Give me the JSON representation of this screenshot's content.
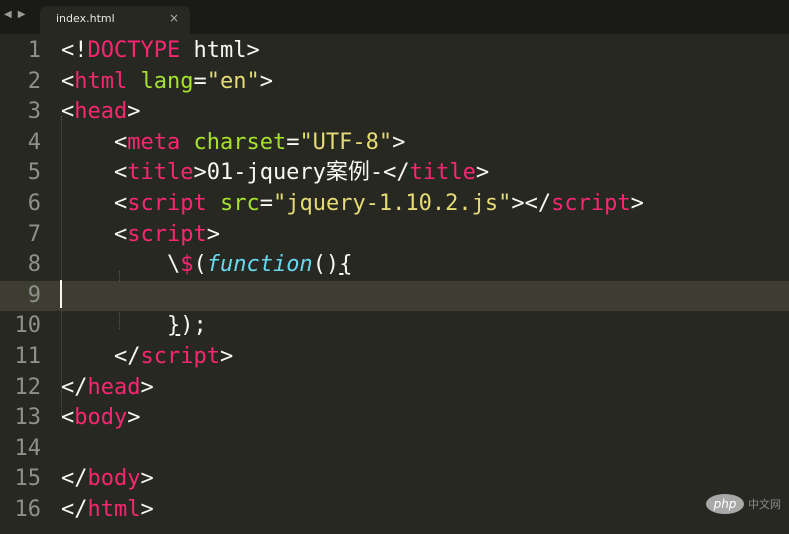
{
  "tabbar": {
    "nav_left": "◀",
    "nav_right": "▶",
    "tab_label": "index.html",
    "tab_close": "×"
  },
  "editor": {
    "current_line": 9,
    "lines": [
      {
        "n": "1",
        "tokens": [
          {
            "t": "<!",
            "c": "p"
          },
          {
            "t": "DOCTYPE",
            "c": "t"
          },
          {
            "t": " html>",
            "c": "p"
          }
        ]
      },
      {
        "n": "2",
        "tokens": [
          {
            "t": "<",
            "c": "p"
          },
          {
            "t": "html",
            "c": "t"
          },
          {
            "t": " ",
            "c": "p"
          },
          {
            "t": "lang",
            "c": "a"
          },
          {
            "t": "=",
            "c": "p"
          },
          {
            "t": "\"en\"",
            "c": "s"
          },
          {
            "t": ">",
            "c": "p"
          }
        ]
      },
      {
        "n": "3",
        "tokens": [
          {
            "t": "<",
            "c": "p"
          },
          {
            "t": "head",
            "c": "t"
          },
          {
            "t": ">",
            "c": "p"
          }
        ]
      },
      {
        "n": "4",
        "tokens": [
          {
            "t": "    <",
            "c": "p"
          },
          {
            "t": "meta",
            "c": "t"
          },
          {
            "t": " ",
            "c": "p"
          },
          {
            "t": "charset",
            "c": "a"
          },
          {
            "t": "=",
            "c": "p"
          },
          {
            "t": "\"UTF-8\"",
            "c": "s"
          },
          {
            "t": ">",
            "c": "p"
          }
        ]
      },
      {
        "n": "5",
        "tokens": [
          {
            "t": "    <",
            "c": "p"
          },
          {
            "t": "title",
            "c": "t"
          },
          {
            "t": ">01-jquery案例-</",
            "c": "p"
          },
          {
            "t": "title",
            "c": "t"
          },
          {
            "t": ">",
            "c": "p"
          }
        ]
      },
      {
        "n": "6",
        "tokens": [
          {
            "t": "    <",
            "c": "p"
          },
          {
            "t": "script",
            "c": "t"
          },
          {
            "t": " ",
            "c": "p"
          },
          {
            "t": "src",
            "c": "a"
          },
          {
            "t": "=",
            "c": "p"
          },
          {
            "t": "\"jquery-1.10.2.js\"",
            "c": "s"
          },
          {
            "t": "></",
            "c": "p"
          },
          {
            "t": "script",
            "c": "t"
          },
          {
            "t": ">",
            "c": "p"
          }
        ]
      },
      {
        "n": "7",
        "tokens": [
          {
            "t": "    <",
            "c": "p"
          },
          {
            "t": "script",
            "c": "t"
          },
          {
            "t": ">",
            "c": "p"
          }
        ]
      },
      {
        "n": "8",
        "tokens": [
          {
            "t": "        \\",
            "c": "p"
          },
          {
            "t": "$",
            "c": "t"
          },
          {
            "t": "(",
            "c": "p"
          },
          {
            "t": "function",
            "c": "k"
          },
          {
            "t": "()",
            "c": "p"
          },
          {
            "t": "{",
            "c": "u"
          }
        ]
      },
      {
        "n": "9",
        "tokens": []
      },
      {
        "n": "10",
        "tokens": [
          {
            "t": "        ",
            "c": "p"
          },
          {
            "t": "}",
            "c": "u"
          },
          {
            "t": ");",
            "c": "p"
          }
        ]
      },
      {
        "n": "11",
        "tokens": [
          {
            "t": "    </",
            "c": "p"
          },
          {
            "t": "script",
            "c": "t"
          },
          {
            "t": ">",
            "c": "p"
          }
        ]
      },
      {
        "n": "12",
        "tokens": [
          {
            "t": "</",
            "c": "p"
          },
          {
            "t": "head",
            "c": "t"
          },
          {
            "t": ">",
            "c": "p"
          }
        ]
      },
      {
        "n": "13",
        "tokens": [
          {
            "t": "<",
            "c": "p"
          },
          {
            "t": "body",
            "c": "t"
          },
          {
            "t": ">",
            "c": "p"
          }
        ]
      },
      {
        "n": "14",
        "tokens": []
      },
      {
        "n": "15",
        "tokens": [
          {
            "t": "</",
            "c": "p"
          },
          {
            "t": "body",
            "c": "t"
          },
          {
            "t": ">",
            "c": "p"
          }
        ]
      },
      {
        "n": "16",
        "tokens": [
          {
            "t": "</",
            "c": "p"
          },
          {
            "t": "html",
            "c": "t"
          },
          {
            "t": ">",
            "c": "p"
          }
        ]
      }
    ]
  },
  "colors": {
    "background": "#272822",
    "tag": "#f92672",
    "attribute": "#a6e22e",
    "string": "#e6db74",
    "keyword": "#66d9ef",
    "text": "#f8f8f2",
    "line_number": "#8f908a"
  },
  "watermark": {
    "logo": "php",
    "text": "中文网"
  }
}
